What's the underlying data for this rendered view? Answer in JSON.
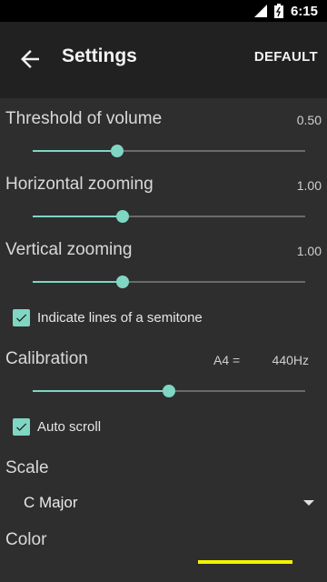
{
  "status_bar": {
    "time": "6:15"
  },
  "app_bar": {
    "title": "Settings",
    "default_label": "DEFAULT"
  },
  "settings": {
    "threshold": {
      "label": "Threshold of volume",
      "value": "0.50",
      "fraction": 0.31
    },
    "horizontal": {
      "label": "Horizontal zooming",
      "value": "1.00",
      "fraction": 0.33
    },
    "vertical": {
      "label": "Vertical zooming",
      "value": "1.00",
      "fraction": 0.33
    },
    "semitone": {
      "label": "Indicate lines of a semitone",
      "checked": true
    },
    "calibration": {
      "label": "Calibration",
      "note": "A4 =",
      "value": "440Hz",
      "fraction": 0.5
    },
    "autoscroll": {
      "label": "Auto scroll",
      "checked": true
    },
    "scale": {
      "label": "Scale",
      "selected": "C Major"
    },
    "color": {
      "label": "Color",
      "swatch": "#f2f200"
    }
  },
  "colors": {
    "accent": "#7fd6c2",
    "appbar": "#212121",
    "background": "#2e2e2e"
  }
}
